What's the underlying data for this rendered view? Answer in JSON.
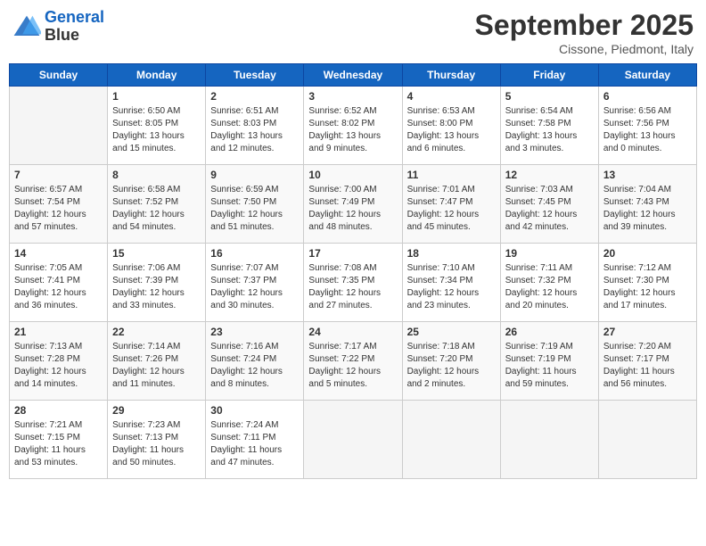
{
  "header": {
    "logo_line1": "General",
    "logo_line2": "Blue",
    "month": "September 2025",
    "location": "Cissone, Piedmont, Italy"
  },
  "days_of_week": [
    "Sunday",
    "Monday",
    "Tuesday",
    "Wednesday",
    "Thursday",
    "Friday",
    "Saturday"
  ],
  "weeks": [
    [
      {
        "num": "",
        "info": ""
      },
      {
        "num": "1",
        "info": "Sunrise: 6:50 AM\nSunset: 8:05 PM\nDaylight: 13 hours\nand 15 minutes."
      },
      {
        "num": "2",
        "info": "Sunrise: 6:51 AM\nSunset: 8:03 PM\nDaylight: 13 hours\nand 12 minutes."
      },
      {
        "num": "3",
        "info": "Sunrise: 6:52 AM\nSunset: 8:02 PM\nDaylight: 13 hours\nand 9 minutes."
      },
      {
        "num": "4",
        "info": "Sunrise: 6:53 AM\nSunset: 8:00 PM\nDaylight: 13 hours\nand 6 minutes."
      },
      {
        "num": "5",
        "info": "Sunrise: 6:54 AM\nSunset: 7:58 PM\nDaylight: 13 hours\nand 3 minutes."
      },
      {
        "num": "6",
        "info": "Sunrise: 6:56 AM\nSunset: 7:56 PM\nDaylight: 13 hours\nand 0 minutes."
      }
    ],
    [
      {
        "num": "7",
        "info": "Sunrise: 6:57 AM\nSunset: 7:54 PM\nDaylight: 12 hours\nand 57 minutes."
      },
      {
        "num": "8",
        "info": "Sunrise: 6:58 AM\nSunset: 7:52 PM\nDaylight: 12 hours\nand 54 minutes."
      },
      {
        "num": "9",
        "info": "Sunrise: 6:59 AM\nSunset: 7:50 PM\nDaylight: 12 hours\nand 51 minutes."
      },
      {
        "num": "10",
        "info": "Sunrise: 7:00 AM\nSunset: 7:49 PM\nDaylight: 12 hours\nand 48 minutes."
      },
      {
        "num": "11",
        "info": "Sunrise: 7:01 AM\nSunset: 7:47 PM\nDaylight: 12 hours\nand 45 minutes."
      },
      {
        "num": "12",
        "info": "Sunrise: 7:03 AM\nSunset: 7:45 PM\nDaylight: 12 hours\nand 42 minutes."
      },
      {
        "num": "13",
        "info": "Sunrise: 7:04 AM\nSunset: 7:43 PM\nDaylight: 12 hours\nand 39 minutes."
      }
    ],
    [
      {
        "num": "14",
        "info": "Sunrise: 7:05 AM\nSunset: 7:41 PM\nDaylight: 12 hours\nand 36 minutes."
      },
      {
        "num": "15",
        "info": "Sunrise: 7:06 AM\nSunset: 7:39 PM\nDaylight: 12 hours\nand 33 minutes."
      },
      {
        "num": "16",
        "info": "Sunrise: 7:07 AM\nSunset: 7:37 PM\nDaylight: 12 hours\nand 30 minutes."
      },
      {
        "num": "17",
        "info": "Sunrise: 7:08 AM\nSunset: 7:35 PM\nDaylight: 12 hours\nand 27 minutes."
      },
      {
        "num": "18",
        "info": "Sunrise: 7:10 AM\nSunset: 7:34 PM\nDaylight: 12 hours\nand 23 minutes."
      },
      {
        "num": "19",
        "info": "Sunrise: 7:11 AM\nSunset: 7:32 PM\nDaylight: 12 hours\nand 20 minutes."
      },
      {
        "num": "20",
        "info": "Sunrise: 7:12 AM\nSunset: 7:30 PM\nDaylight: 12 hours\nand 17 minutes."
      }
    ],
    [
      {
        "num": "21",
        "info": "Sunrise: 7:13 AM\nSunset: 7:28 PM\nDaylight: 12 hours\nand 14 minutes."
      },
      {
        "num": "22",
        "info": "Sunrise: 7:14 AM\nSunset: 7:26 PM\nDaylight: 12 hours\nand 11 minutes."
      },
      {
        "num": "23",
        "info": "Sunrise: 7:16 AM\nSunset: 7:24 PM\nDaylight: 12 hours\nand 8 minutes."
      },
      {
        "num": "24",
        "info": "Sunrise: 7:17 AM\nSunset: 7:22 PM\nDaylight: 12 hours\nand 5 minutes."
      },
      {
        "num": "25",
        "info": "Sunrise: 7:18 AM\nSunset: 7:20 PM\nDaylight: 12 hours\nand 2 minutes."
      },
      {
        "num": "26",
        "info": "Sunrise: 7:19 AM\nSunset: 7:19 PM\nDaylight: 11 hours\nand 59 minutes."
      },
      {
        "num": "27",
        "info": "Sunrise: 7:20 AM\nSunset: 7:17 PM\nDaylight: 11 hours\nand 56 minutes."
      }
    ],
    [
      {
        "num": "28",
        "info": "Sunrise: 7:21 AM\nSunset: 7:15 PM\nDaylight: 11 hours\nand 53 minutes."
      },
      {
        "num": "29",
        "info": "Sunrise: 7:23 AM\nSunset: 7:13 PM\nDaylight: 11 hours\nand 50 minutes."
      },
      {
        "num": "30",
        "info": "Sunrise: 7:24 AM\nSunset: 7:11 PM\nDaylight: 11 hours\nand 47 minutes."
      },
      {
        "num": "",
        "info": ""
      },
      {
        "num": "",
        "info": ""
      },
      {
        "num": "",
        "info": ""
      },
      {
        "num": "",
        "info": ""
      }
    ]
  ]
}
